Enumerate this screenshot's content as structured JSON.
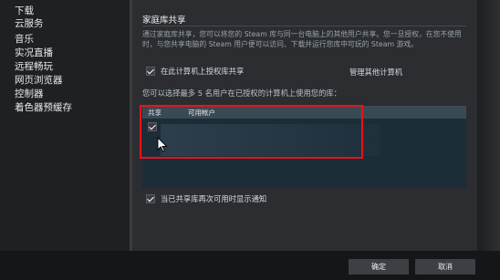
{
  "sidebar": {
    "items": [
      {
        "label": "下载"
      },
      {
        "label": "云服务"
      },
      {
        "label": "音乐"
      },
      {
        "label": "实况直播"
      },
      {
        "label": "远程畅玩"
      },
      {
        "label": "网页浏览器"
      },
      {
        "label": "控制器"
      },
      {
        "label": "着色器预缓存"
      }
    ]
  },
  "family": {
    "title": "家庭库共享",
    "description": "通过家庭库共享，您可以将您的 Steam 库与同一台电脑上的其他用户共享。您一旦授权，在您不使用时，与您共享电脑的 Steam 用户便可以访问、下载并运行您库中可玩的 Steam 游戏。",
    "authorize_label": "在此计算机上授权库共享",
    "authorize_checked": true,
    "manage_label": "管理其他计算机",
    "limit_text": "您可以选择最多 5 名用户在已授权的计算机上使用您的库：",
    "table": {
      "col_share": "共享",
      "col_accounts": "可用帐户",
      "row_checked": true
    },
    "notify_label": "当已共享库再次可用时显示通知",
    "notify_checked": true
  },
  "footer": {
    "ok_label": "确定",
    "cancel_label": "取消"
  },
  "colors": {
    "highlight": "#e8131a"
  }
}
